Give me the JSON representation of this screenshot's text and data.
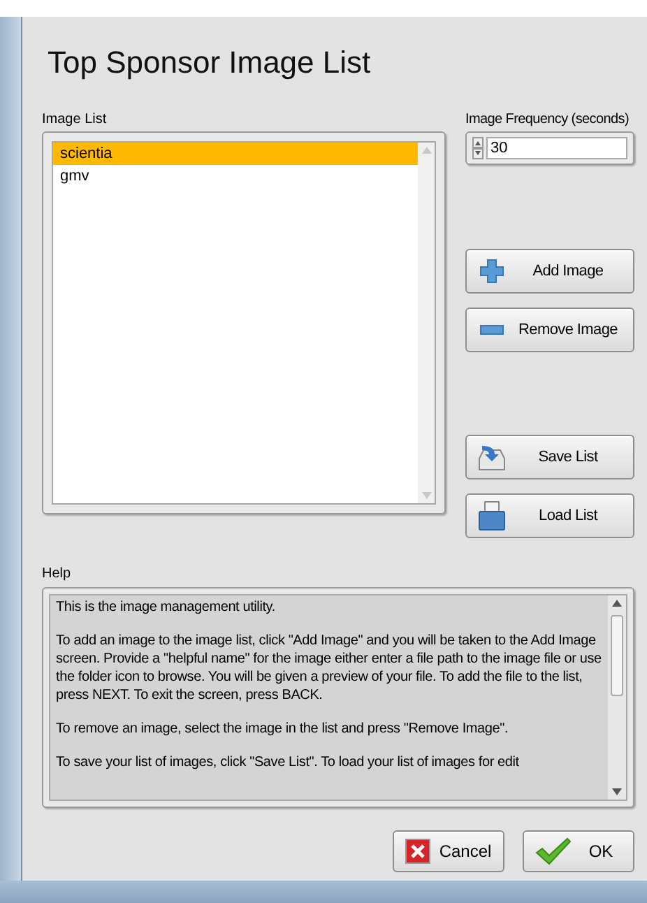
{
  "title": "Top Sponsor Image List",
  "image_list": {
    "label": "Image List",
    "items": [
      {
        "name": "scientia",
        "selected": true
      },
      {
        "name": "gmv",
        "selected": false
      }
    ]
  },
  "frequency": {
    "label": "Image Frequency (seconds)",
    "value": "30"
  },
  "actions": [
    {
      "kind": "add",
      "label": "Add Image"
    },
    {
      "kind": "remove",
      "label": "Remove Image"
    },
    {
      "kind": "save",
      "label": "Save List"
    },
    {
      "kind": "load",
      "label": "Load List"
    }
  ],
  "help": {
    "label": "Help",
    "paragraphs": [
      "This is the image management utility.",
      "To add an image to the image list, click \"Add Image\" and you will be taken to the Add Image screen.  Provide a \"helpful name\" for the image either enter a file path to the image file or use the folder icon to browse.  You will be given a preview of your file.  To add the file to the list, press NEXT.  To exit the screen, press BACK.",
      "To remove an image, select the image in the list and press \"Remove Image\".",
      "To save your list of images, click \"Save List\".  To load your list of images for edit"
    ]
  },
  "buttons": [
    {
      "kind": "cancel",
      "label": "Cancel"
    },
    {
      "kind": "ok",
      "label": "OK"
    }
  ]
}
